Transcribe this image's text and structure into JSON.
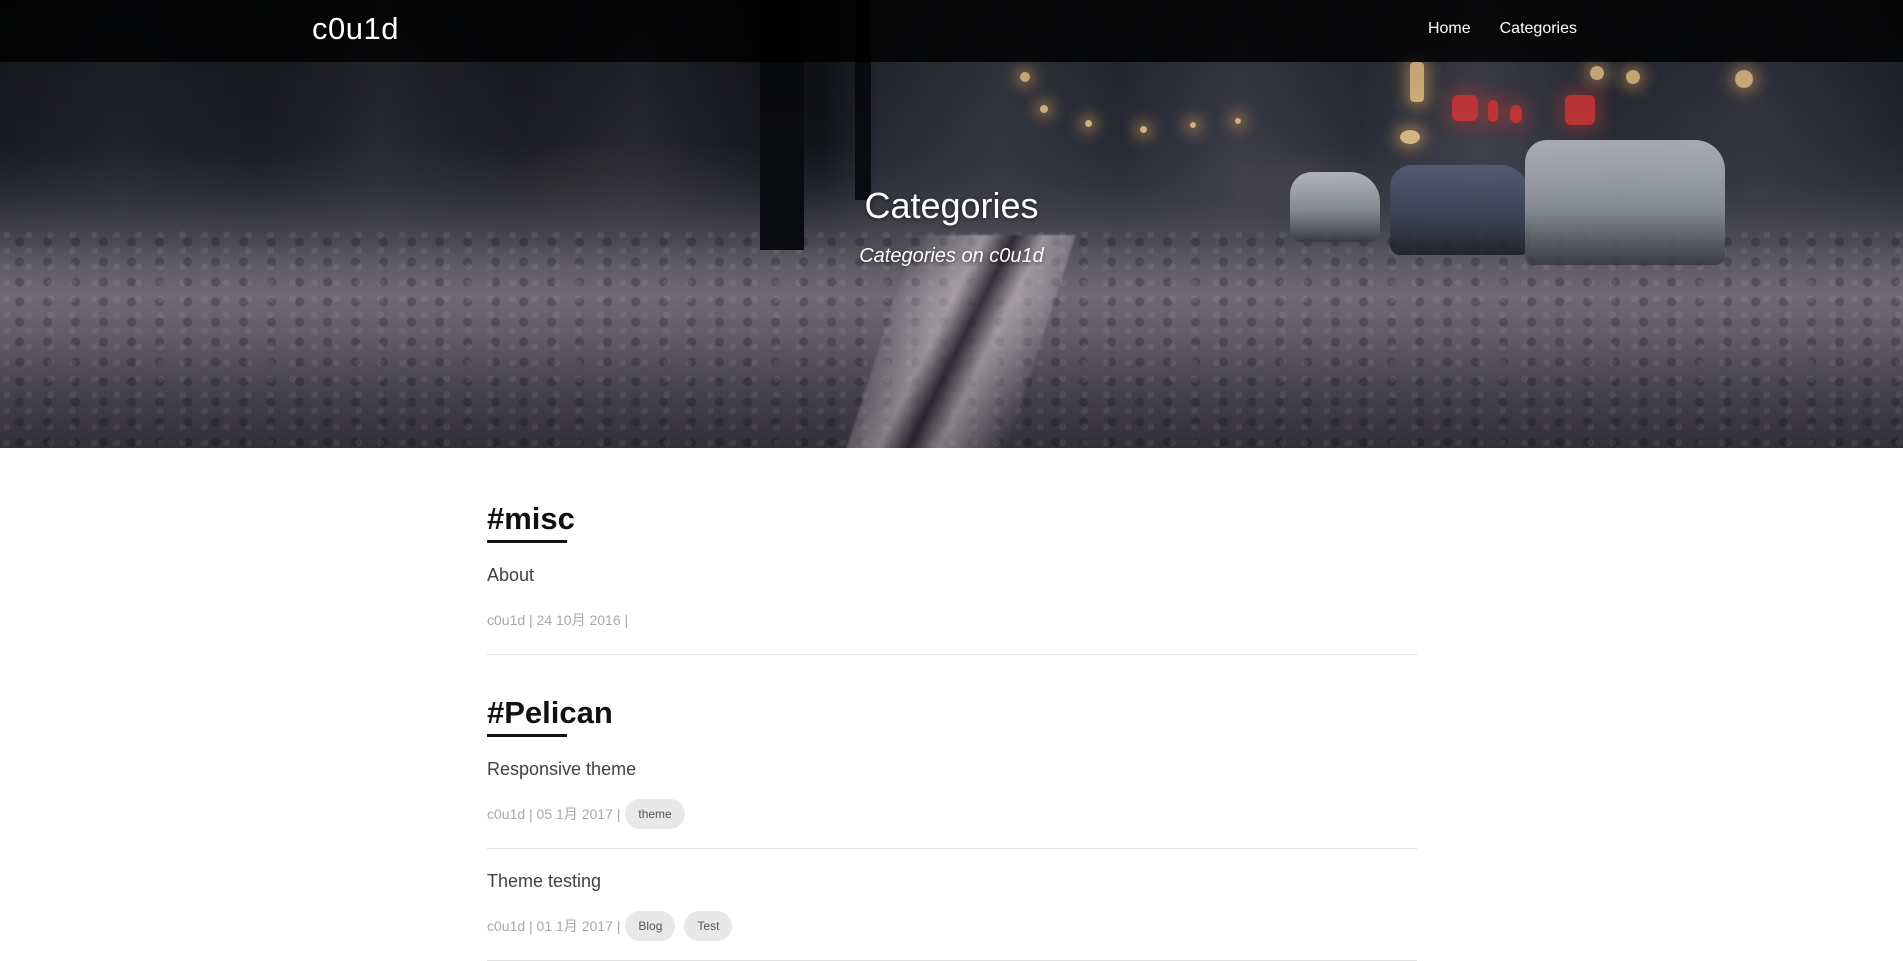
{
  "site": {
    "brand": "c0u1d"
  },
  "nav": {
    "items": [
      {
        "label": "Home"
      },
      {
        "label": "Categories"
      }
    ]
  },
  "hero": {
    "title": "Categories",
    "subtitle": "Categories on c0u1d"
  },
  "categories": [
    {
      "name": "#misc",
      "posts": [
        {
          "title": "About",
          "meta": "c0u1d | 24 10月 2016 |",
          "tags": []
        }
      ]
    },
    {
      "name": "#Pelican",
      "posts": [
        {
          "title": "Responsive theme",
          "meta": "c0u1d | 05 1月 2017 |",
          "tags": [
            "theme"
          ]
        },
        {
          "title": "Theme testing",
          "meta": "c0u1d | 01 1月 2017 |",
          "tags": [
            "Blog",
            "Test"
          ]
        }
      ]
    }
  ],
  "colors": {
    "navbar_bg": "#000000",
    "heading": "#111111",
    "post_title": "#404040",
    "meta": "#a8a8a8",
    "tag_bg": "#e8e8e8"
  }
}
